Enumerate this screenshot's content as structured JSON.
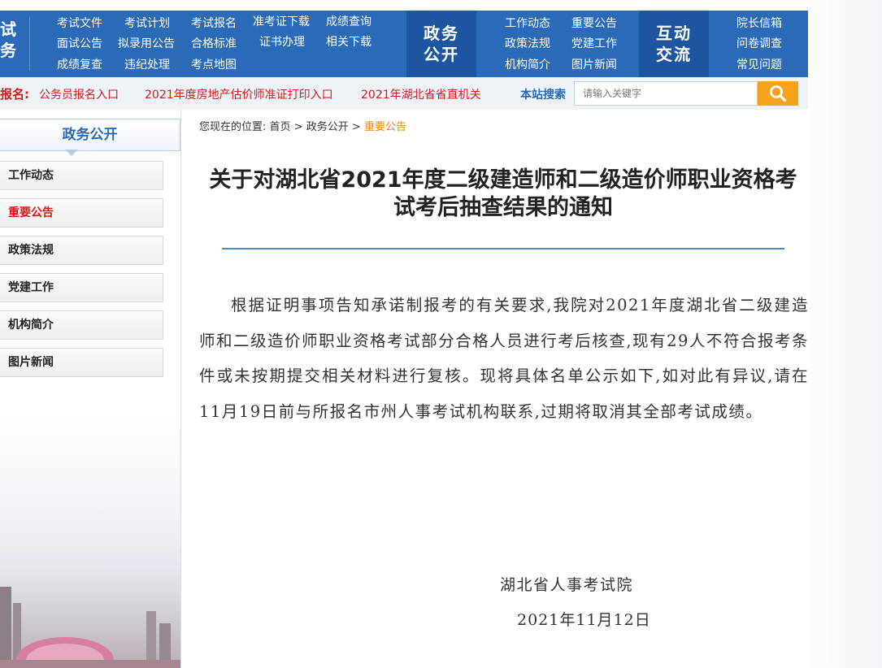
{
  "nav": {
    "side_chars": [
      "试",
      "务"
    ],
    "col1": [
      "考试文件",
      "面试公告",
      "成绩复查"
    ],
    "col2": [
      "考试计划",
      "拟录用公告",
      "违纪处理"
    ],
    "col3": [
      "考试报名",
      "合格标准",
      "考点地图"
    ],
    "col4": [
      "准考证下载",
      "证书办理"
    ],
    "col5": [
      "成绩查询",
      "相关下载"
    ],
    "block1": [
      "政务",
      "公开"
    ],
    "col6": [
      "工作动态",
      "政策法规",
      "机构简介"
    ],
    "col7": [
      "重要公告",
      "党建工作",
      "图片新闻"
    ],
    "block2": [
      "互动",
      "交流"
    ],
    "col8": [
      "院长信箱",
      "问卷调查",
      "常见问题"
    ]
  },
  "ticker": {
    "label": "报名:",
    "items": [
      "公务员报名入口",
      "2021年度房地产估价师准证打印入口",
      "2021年湖北省省直机关"
    ],
    "search_label": "本站搜索",
    "search_placeholder": "请输入关键字"
  },
  "sidebar": {
    "title": "政务公开",
    "items": [
      "工作动态",
      "重要公告",
      "政策法规",
      "党建工作",
      "机构简介",
      "图片新闻"
    ],
    "active_index": 1
  },
  "breadcrumb": {
    "prefix": "您现在的位置:",
    "home": "首页",
    "sep": ">",
    "section": "政务公开",
    "current": "重要公告"
  },
  "article": {
    "title": "关于对湖北省2021年度二级建造师和二级造价师职业资格考试考后抽查结果的通知",
    "body": "根据证明事项告知承诺制报考的有关要求,我院对2021年度湖北省二级建造师和二级造价师职业资格考试部分合格人员进行考后核查,现有29人不符合报考条件或未按期提交相关材料进行复核。现将具体名单公示如下,如对此有异议,请在11月19日前与所报名市州人事考试机构联系,过期将取消其全部考试成绩。",
    "signature": "湖北省人事考试院",
    "date": "2021年11月12日"
  },
  "colors": {
    "nav_blue": "#2a6ab7",
    "nav_dark": "#1e55a0",
    "alert_red": "#d71818",
    "search_orange": "#f5a31a",
    "crumb_current": "#e08a10"
  }
}
